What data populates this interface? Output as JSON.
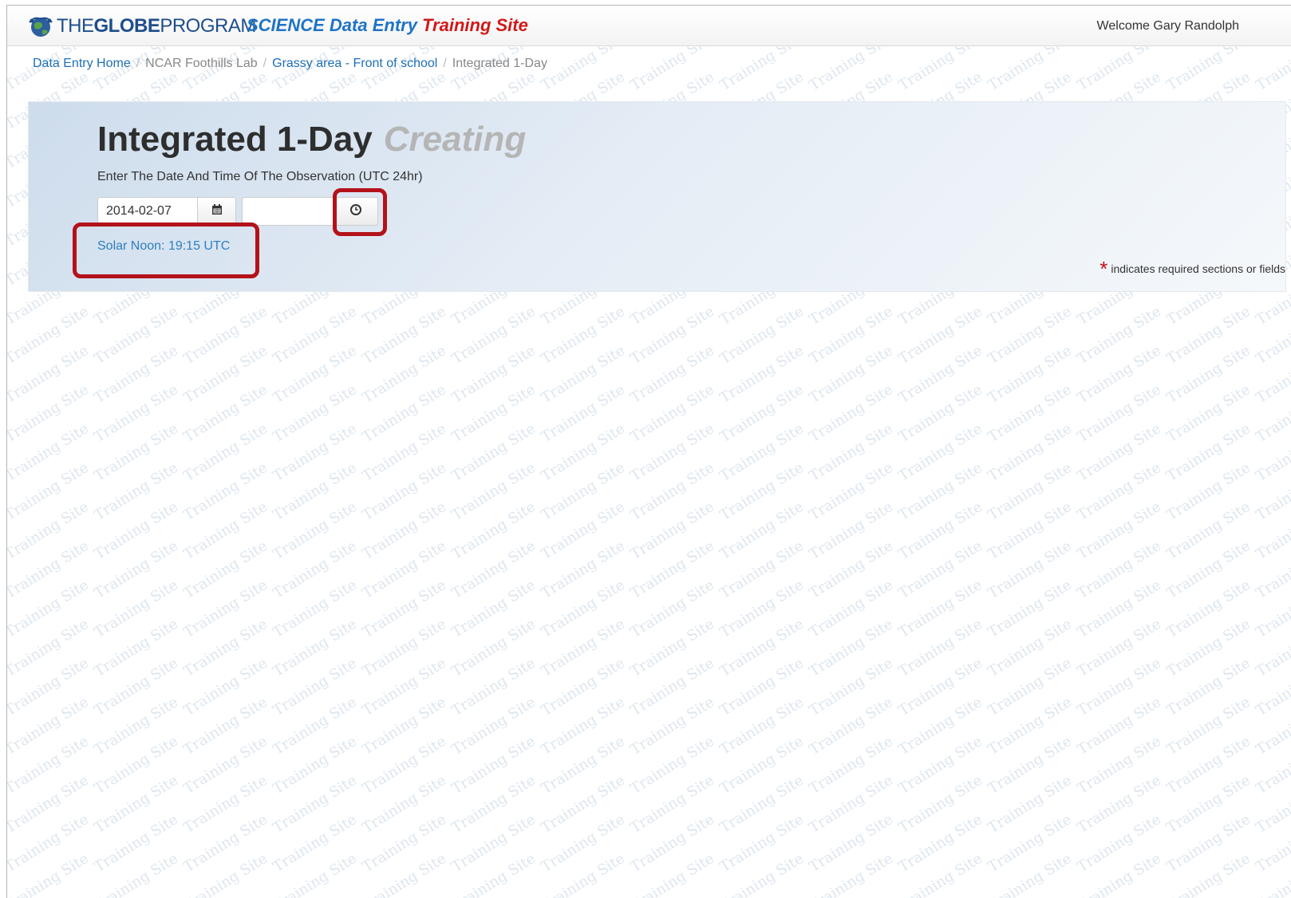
{
  "header": {
    "brand_prefix": "THE",
    "brand_bold": "GLOBE",
    "brand_suffix": "PROGRAM",
    "science_label": "SCIENCE Data Entry",
    "training_label": "Training Site",
    "welcome": "Welcome Gary Randolph"
  },
  "breadcrumb": {
    "items": [
      {
        "label": "Data Entry Home",
        "link": true
      },
      {
        "label": "NCAR Foothills Lab",
        "link": false
      },
      {
        "label": "Grassy area - Front of school",
        "link": true
      },
      {
        "label": "Integrated 1-Day",
        "link": false
      }
    ]
  },
  "panel": {
    "title": "Integrated 1-Day",
    "status": "Creating",
    "instruction": "Enter The Date And Time Of The Observation (UTC 24hr)",
    "date_value": "2014-02-07",
    "time_value": "",
    "solar_noon": "Solar Noon: 19:15 UTC",
    "required_star": "*",
    "required_note": "indicates required sections or fields"
  },
  "watermark": {
    "text": "Training Site"
  },
  "colors": {
    "brand_blue": "#1e4e8c",
    "science_blue": "#1e73c7",
    "training_red": "#d01919",
    "link_blue": "#1e6fb7",
    "highlight_red": "#b4121a"
  }
}
